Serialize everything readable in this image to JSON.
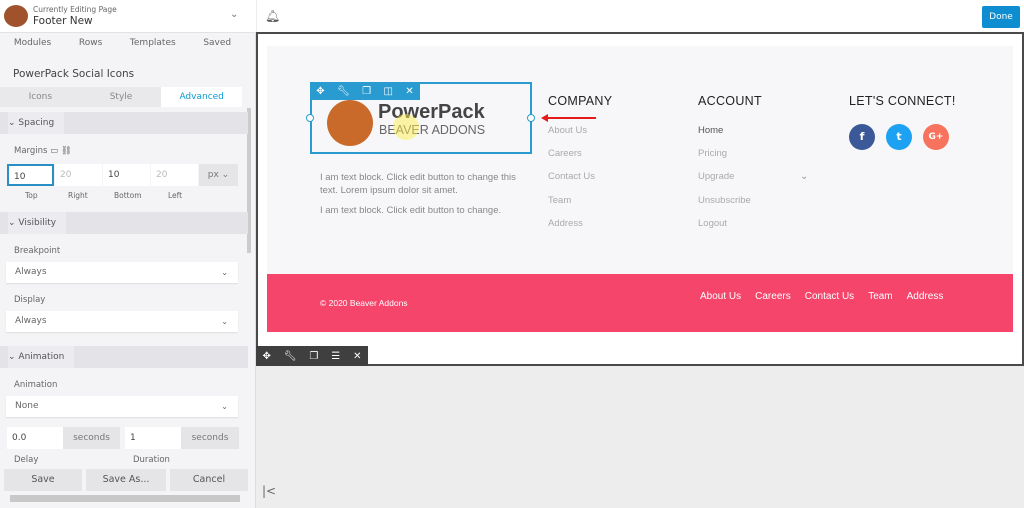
{
  "header": {
    "caption": "Currently Editing Page",
    "page": "Footer New"
  },
  "tabs": [
    "Modules",
    "Rows",
    "Templates",
    "Saved"
  ],
  "module_title": "PowerPack Social Icons",
  "subtabs": [
    "Icons",
    "Style",
    "Advanced"
  ],
  "spacing": {
    "title": "Spacing",
    "margins_label": "Margins",
    "values": [
      "10",
      "20",
      "10",
      "20"
    ],
    "labels": [
      "Top",
      "Right",
      "Bottom",
      "Left"
    ],
    "unit": "px"
  },
  "visibility": {
    "title": "Visibility",
    "breakpoint_label": "Breakpoint",
    "breakpoint": "Always",
    "display_label": "Display",
    "display": "Always"
  },
  "animation": {
    "title": "Animation",
    "animation_label": "Animation",
    "animation": "None",
    "delay": "0.0",
    "delay_unit": "seconds",
    "delay_label": "Delay",
    "duration": "1",
    "duration_unit": "seconds",
    "duration_label": "Duration"
  },
  "actions": {
    "save": "Save",
    "save_as": "Save As...",
    "cancel": "Cancel"
  },
  "topbar": {
    "done": "Done"
  },
  "logo": {
    "line1": "PowerPack",
    "line2": "BEAVER ADDONS"
  },
  "text_blocks": [
    "I am text block. Click edit button to change this text. Lorem ipsum dolor sit amet.",
    "I am text block. Click edit button to change."
  ],
  "company": {
    "title": "COMPANY",
    "links": [
      "About Us",
      "Careers",
      "Contact Us",
      "Team",
      "Address"
    ]
  },
  "account": {
    "title": "ACCOUNT",
    "links": [
      "Home",
      "Pricing",
      "Upgrade",
      "Unsubscribe",
      "Logout"
    ]
  },
  "connect": {
    "title": "LET'S CONNECT!",
    "icons": [
      {
        "name": "facebook",
        "color": "#3b5998",
        "glyph": "f"
      },
      {
        "name": "twitter",
        "color": "#1da1f2",
        "glyph": "t"
      },
      {
        "name": "google-plus",
        "color": "#f7735e",
        "glyph": "G+"
      }
    ]
  },
  "footer": {
    "copyright": "© 2020 Beaver Addons",
    "links": [
      "About Us",
      "Careers",
      "Contact Us",
      "Team",
      "Address"
    ],
    "color": "#f5456b"
  },
  "accent": "#0e8ed0"
}
